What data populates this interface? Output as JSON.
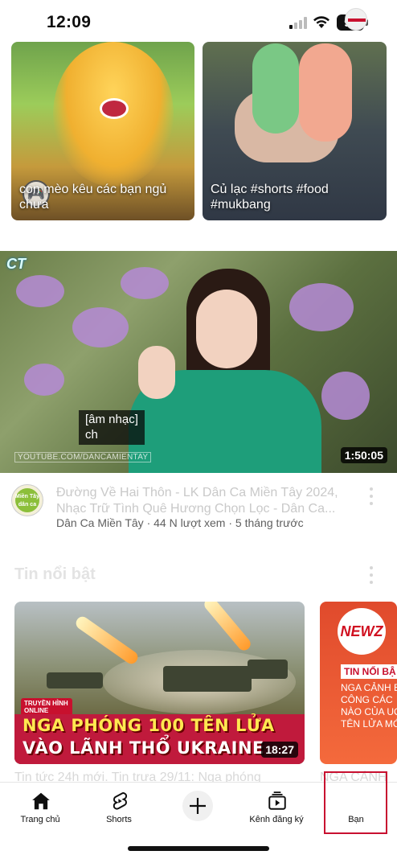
{
  "status_bar": {
    "time": "12:09",
    "battery": "94"
  },
  "shorts": [
    {
      "title": "con mèo kêu các bạn ngủ chưa"
    },
    {
      "title": "Củ lạc #shorts #food #mukbang"
    }
  ],
  "main_video": {
    "logo": "CT",
    "caption_line1": "[âm nhạc]",
    "caption_line2": "ch",
    "watermark": "YOUTUBE.COM/DANCAMIENTAY",
    "duration": "1:50:05",
    "title": "Đường Về Hai Thôn - LK Dân Ca Miền Tây 2024, Nhạc Trữ Tình Quê Hương Chọn Lọc - Dân Ca...",
    "meta": "Dân Ca Miền Tây · 44 N lượt xem · 5 tháng trước",
    "channel_avatar_text": "Miền Tây dân ca"
  },
  "news_section": {
    "title": "Tin nổi bật",
    "cards": [
      {
        "headline_line1": "NGA PHÓNG 100 TÊN LỬA",
        "headline_line2": "VÀO LÃNH THỔ UKRAINE",
        "logo_text": "TRUYỀN HÌNH ONLINE",
        "duration": "18:27",
        "title": "Tin tức 24h mới. Tin trưa 29/11: Nga phóng"
      },
      {
        "logo_text": "NEWZ",
        "tag": "TIN NỔI BẬ",
        "text_line1": "NGA CẢNH B",
        "text_line2": "CÔNG CÁC",
        "text_line3": "NÀO CỦA UC",
        "text_line4": "TÊN LỬA MỚI",
        "title": "NGA CẢNH"
      }
    ]
  },
  "bottom_nav": {
    "items": [
      {
        "label": "Trang chủ",
        "icon": "home-icon"
      },
      {
        "label": "Shorts",
        "icon": "shorts-icon"
      },
      {
        "label": "",
        "icon": "plus-icon"
      },
      {
        "label": "Kênh đăng ký",
        "icon": "subscriptions-icon"
      },
      {
        "label": "Bạn",
        "icon": "avatar"
      }
    ]
  },
  "colors": {
    "accent_red": "#c81030",
    "headline_band": "#c01a3c",
    "meta_gray": "#606060"
  }
}
